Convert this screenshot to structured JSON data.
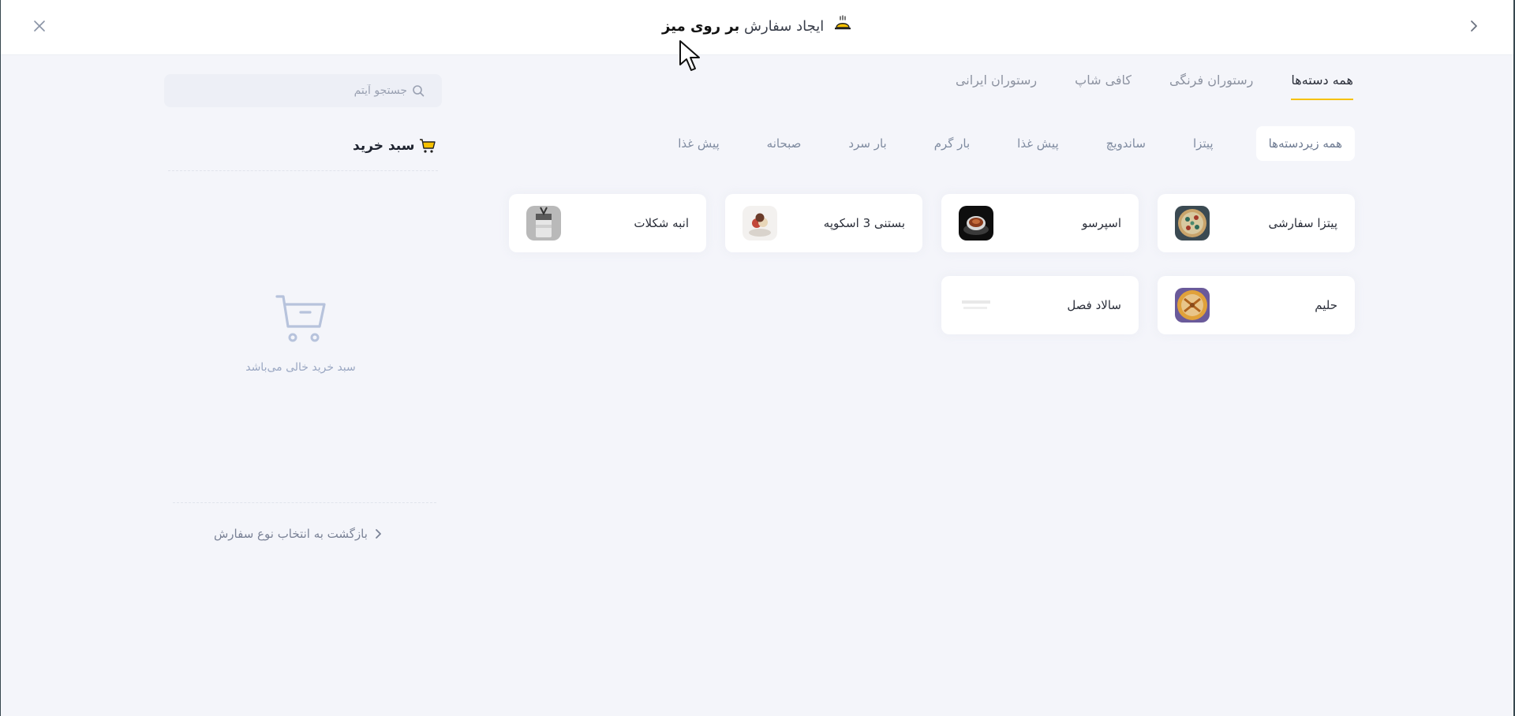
{
  "header": {
    "title_prefix": "ایجاد سفارش",
    "title_strong": "بر روی میز",
    "accent_color": "#f6c100"
  },
  "categories": [
    {
      "label": "همه دسته‌ها",
      "active": true
    },
    {
      "label": "رستوران فرنگی",
      "active": false
    },
    {
      "label": "کافی شاپ",
      "active": false
    },
    {
      "label": "رستوران ایرانی",
      "active": false
    }
  ],
  "subcategories": [
    {
      "label": "همه زیردسته‌ها",
      "active": true
    },
    {
      "label": "پیتزا",
      "active": false
    },
    {
      "label": "ساندویچ",
      "active": false
    },
    {
      "label": "پیش غذا",
      "active": false
    },
    {
      "label": "بار گرم",
      "active": false
    },
    {
      "label": "بار سرد",
      "active": false
    },
    {
      "label": "صبحانه",
      "active": false
    },
    {
      "label": "پیش غذا",
      "active": false
    }
  ],
  "items": [
    {
      "name": "پیتزا سفارشی",
      "thumb": "pizza-thumb"
    },
    {
      "name": "اسپرسو",
      "thumb": "espresso-thumb"
    },
    {
      "name": "بستنی 3 اسکوپه",
      "thumb": "icecream-thumb"
    },
    {
      "name": "انبه شکلات",
      "thumb": "mango-chocolate-thumb"
    },
    {
      "name": "حلیم",
      "thumb": "haleem-thumb"
    },
    {
      "name": "سالاد فصل",
      "thumb": "salad-thumb"
    }
  ],
  "search": {
    "placeholder": "جستجو آیتم"
  },
  "cart": {
    "title": "سبد خرید",
    "empty_text": "سبد خرید خالی می‌باشد",
    "back_label": "بازگشت به انتخاب نوع سفارش"
  }
}
